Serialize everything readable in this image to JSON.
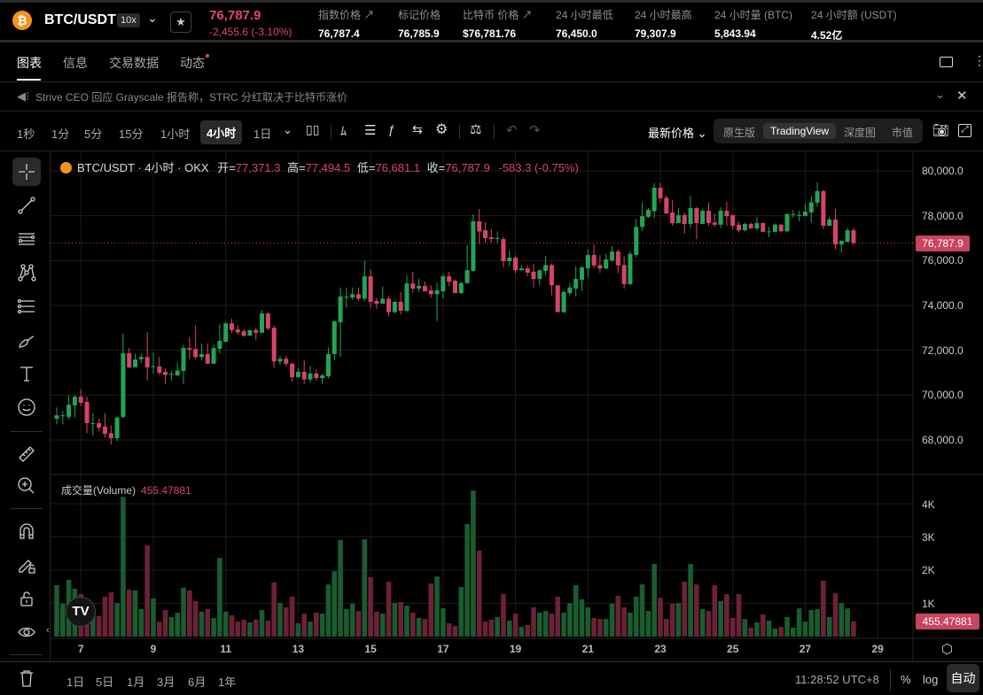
{
  "header": {
    "symbol": "BTC/USDT",
    "leverage": "10x",
    "last_price": "76,787.9",
    "change": "-2,455.6 (-3.10%)",
    "stats": [
      {
        "label": "指数价格 ↗",
        "value": "76,787.4"
      },
      {
        "label": "标记价格",
        "value": "76,785.9"
      },
      {
        "label": "比特币 价格 ↗",
        "value": "$76,781.76"
      },
      {
        "label": "24 小时最低",
        "value": "76,450.0"
      },
      {
        "label": "24 小时最高",
        "value": "79,307.9"
      },
      {
        "label": "24 小时量 (BTC)",
        "value": "5,843.94"
      },
      {
        "label": "24 小时额 (USDT)",
        "value": "4.52亿"
      }
    ]
  },
  "tabs": [
    "图表",
    "信息",
    "交易数据",
    "动态"
  ],
  "news": "Strive CEO 回应 Grayscale 报告称，STRC 分红取决于比特币涨价",
  "toolbar": {
    "intervals": [
      "1秒",
      "1分",
      "5分",
      "15分",
      "1小时",
      "4小时",
      "1日"
    ],
    "active_interval": "4小时",
    "price_source": "最新价格",
    "views": [
      "原生版",
      "TradingView",
      "深度图",
      "市值"
    ],
    "active_view": "TradingView"
  },
  "legend": {
    "title": "BTC/USDT · 4小时 · OKX",
    "open_label": "开=",
    "open": "77,371.3",
    "high_label": "高=",
    "high": "77,494.5",
    "low_label": "低=",
    "low": "76,681.1",
    "close_label": "收=",
    "close": "76,787.9",
    "change": "-583.3 (-0.75%)"
  },
  "volume_legend": {
    "label": "成交量(Volume)",
    "value": "455.47881"
  },
  "bottom": {
    "ranges": [
      "1日",
      "5日",
      "1月",
      "3月",
      "6月",
      "1年"
    ],
    "clock": "11:28:52 UTC+8",
    "percent": "%",
    "log": "log",
    "auto": "自动"
  },
  "colors": {
    "up": "#23a455",
    "down": "#d8436a",
    "vol_up": "#1a5c2e",
    "vol_down": "#6b2236",
    "price_tag": "#c8445f"
  },
  "chart_data": {
    "type": "candlestick",
    "interval": "4h",
    "price_axis": {
      "ticks": [
        "80,000.0",
        "78,000.0",
        "76,000.0",
        "74,000.0",
        "72,000.0",
        "70,000.0",
        "68,000.0"
      ],
      "tick_values": [
        80000,
        78000,
        76000,
        74000,
        72000,
        70000,
        68000
      ],
      "current": "76,787.9",
      "current_value": 76787.9
    },
    "volume_axis": {
      "ticks": [
        "4K",
        "3K",
        "2K",
        "1K"
      ],
      "tick_values": [
        4000,
        3000,
        2000,
        1000
      ],
      "current": "455.47881"
    },
    "x_ticks": [
      {
        "label": "7",
        "candle": 4
      },
      {
        "label": "9",
        "candle": 16
      },
      {
        "label": "11",
        "candle": 28
      },
      {
        "label": "13",
        "candle": 40
      },
      {
        "label": "15",
        "candle": 52
      },
      {
        "label": "17",
        "candle": 64
      },
      {
        "label": "19",
        "candle": 76
      },
      {
        "label": "21",
        "candle": 88
      },
      {
        "label": "23",
        "candle": 100
      },
      {
        "label": "25",
        "candle": 112
      },
      {
        "label": "27",
        "candle": 124
      },
      {
        "label": "29",
        "candle": 136
      }
    ],
    "ohlc": [
      [
        68950,
        69450,
        68700,
        69100
      ],
      [
        69100,
        69300,
        68700,
        69100
      ],
      [
        69030,
        70000,
        68900,
        69570
      ],
      [
        69540,
        70000,
        69000,
        69930
      ],
      [
        69930,
        70250,
        69500,
        69660
      ],
      [
        69700,
        69930,
        68300,
        68750
      ],
      [
        68750,
        69200,
        68200,
        68750
      ],
      [
        68750,
        68950,
        68400,
        68550
      ],
      [
        68600,
        69200,
        68100,
        68270
      ],
      [
        68300,
        68650,
        67800,
        68080
      ],
      [
        68080,
        69050,
        67950,
        69000
      ],
      [
        69030,
        72740,
        68950,
        71870
      ],
      [
        71870,
        72100,
        71200,
        71240
      ],
      [
        71240,
        71850,
        71240,
        71590
      ],
      [
        71600,
        71850,
        71450,
        71700
      ],
      [
        71700,
        72800,
        70650,
        71240
      ],
      [
        71280,
        71900,
        70950,
        71290
      ],
      [
        71280,
        71700,
        70900,
        71000
      ],
      [
        71040,
        71200,
        70500,
        70900
      ],
      [
        70950,
        71100,
        70650,
        70950
      ],
      [
        70880,
        71450,
        70850,
        71100
      ],
      [
        71080,
        72250,
        70500,
        72100
      ],
      [
        72100,
        72600,
        71600,
        72030
      ],
      [
        72060,
        73100,
        71600,
        71700
      ],
      [
        71700,
        72300,
        71550,
        71830
      ],
      [
        71830,
        72300,
        71400,
        71400
      ],
      [
        71400,
        72250,
        71400,
        72100
      ],
      [
        72070,
        73170,
        71850,
        72420
      ],
      [
        72380,
        73250,
        72350,
        73200
      ],
      [
        73200,
        73400,
        72750,
        72900
      ],
      [
        72930,
        73100,
        72700,
        72800
      ],
      [
        72850,
        72950,
        72600,
        72650
      ],
      [
        72650,
        72900,
        72650,
        72900
      ],
      [
        72900,
        73000,
        72450,
        72780
      ],
      [
        72780,
        73800,
        72780,
        73640
      ],
      [
        73640,
        73700,
        72900,
        72970
      ],
      [
        73000,
        73100,
        71200,
        71500
      ],
      [
        71500,
        71750,
        71350,
        71620
      ],
      [
        71620,
        71750,
        71300,
        71400
      ],
      [
        71400,
        71450,
        70600,
        70800
      ],
      [
        70800,
        71200,
        70800,
        71040
      ],
      [
        71040,
        71550,
        70500,
        70700
      ],
      [
        70700,
        71300,
        70550,
        70960
      ],
      [
        70960,
        71150,
        70650,
        70760
      ],
      [
        70760,
        70950,
        70500,
        70880
      ],
      [
        70840,
        72120,
        70750,
        71830
      ],
      [
        71830,
        73350,
        71550,
        73290
      ],
      [
        73250,
        74800,
        71700,
        74400
      ],
      [
        74390,
        74800,
        73900,
        74390
      ],
      [
        74350,
        74800,
        74250,
        74500
      ],
      [
        74500,
        74800,
        74200,
        74300
      ],
      [
        74300,
        76000,
        74200,
        75300
      ],
      [
        75300,
        75600,
        73900,
        74160
      ],
      [
        74200,
        74330,
        73850,
        74080
      ],
      [
        74080,
        74850,
        74080,
        74300
      ],
      [
        74300,
        74400,
        73500,
        73700
      ],
      [
        73700,
        74200,
        73650,
        74160
      ],
      [
        74160,
        74600,
        73600,
        73760
      ],
      [
        73760,
        75350,
        73700,
        74980
      ],
      [
        74980,
        75500,
        74570,
        74750
      ],
      [
        74750,
        75200,
        74600,
        74870
      ],
      [
        74870,
        75070,
        74650,
        74630
      ],
      [
        74670,
        74900,
        74350,
        74500
      ],
      [
        74500,
        75000,
        73300,
        74670
      ],
      [
        74630,
        75400,
        74300,
        75300
      ],
      [
        75300,
        75500,
        74850,
        75060
      ],
      [
        75100,
        75150,
        74550,
        74550
      ],
      [
        74550,
        75050,
        74500,
        75000
      ],
      [
        75000,
        76700,
        74950,
        75570
      ],
      [
        75540,
        78060,
        75500,
        77750
      ],
      [
        77750,
        78300,
        76750,
        77300
      ],
      [
        77350,
        77700,
        76800,
        77000
      ],
      [
        77040,
        77400,
        76800,
        76960
      ],
      [
        77000,
        77300,
        76750,
        77000
      ],
      [
        76960,
        77050,
        75700,
        75970
      ],
      [
        75970,
        76450,
        75750,
        76130
      ],
      [
        76130,
        76230,
        75430,
        75570
      ],
      [
        75570,
        75800,
        75570,
        75650
      ],
      [
        75650,
        75800,
        75300,
        75460
      ],
      [
        75500,
        75850,
        74800,
        75180
      ],
      [
        75180,
        75600,
        74900,
        75570
      ],
      [
        75540,
        76200,
        75350,
        75800
      ],
      [
        75800,
        75870,
        74450,
        74900
      ],
      [
        74900,
        74900,
        73700,
        73700
      ],
      [
        73700,
        74650,
        73650,
        74600
      ],
      [
        74550,
        75000,
        74450,
        74800
      ],
      [
        74750,
        75750,
        74400,
        75180
      ],
      [
        75140,
        75750,
        74650,
        75700
      ],
      [
        75650,
        76500,
        75250,
        76250
      ],
      [
        76250,
        76700,
        75650,
        75780
      ],
      [
        75800,
        76250,
        75450,
        75650
      ],
      [
        75650,
        76300,
        75600,
        76050
      ],
      [
        76000,
        76650,
        75950,
        76400
      ],
      [
        76400,
        76500,
        75450,
        75780
      ],
      [
        75800,
        76200,
        74750,
        74950
      ],
      [
        74950,
        76400,
        74900,
        76300
      ],
      [
        76250,
        77850,
        76150,
        77500
      ],
      [
        77500,
        78600,
        77300,
        77980
      ],
      [
        77950,
        78350,
        77900,
        78260
      ],
      [
        78200,
        79450,
        77900,
        79250
      ],
      [
        79250,
        79480,
        78600,
        78780
      ],
      [
        78800,
        78900,
        78100,
        78100
      ],
      [
        78140,
        78700,
        77550,
        77670
      ],
      [
        77670,
        78350,
        77670,
        78030
      ],
      [
        78030,
        78150,
        77200,
        77630
      ],
      [
        77630,
        78870,
        77450,
        78340
      ],
      [
        78340,
        78400,
        76950,
        77670
      ],
      [
        77630,
        78300,
        77630,
        78220
      ],
      [
        78220,
        78600,
        77550,
        77670
      ],
      [
        77700,
        78100,
        77500,
        77600
      ],
      [
        77600,
        78380,
        77450,
        78220
      ],
      [
        78220,
        78600,
        77550,
        77980
      ],
      [
        78030,
        78030,
        77400,
        77550
      ],
      [
        77600,
        77750,
        77250,
        77350
      ],
      [
        77350,
        77700,
        77300,
        77630
      ],
      [
        77630,
        77700,
        77550,
        77430
      ],
      [
        77430,
        77950,
        77350,
        77670
      ],
      [
        77670,
        77700,
        77270,
        77280
      ],
      [
        77300,
        77500,
        77050,
        77300
      ],
      [
        77280,
        77650,
        77280,
        77600
      ],
      [
        77600,
        77650,
        77300,
        77300
      ],
      [
        77300,
        78120,
        77300,
        78070
      ],
      [
        78070,
        78250,
        77900,
        78070
      ],
      [
        78030,
        78220,
        77750,
        78030
      ],
      [
        77980,
        78550,
        77980,
        78180
      ],
      [
        78140,
        78900,
        77700,
        78600
      ],
      [
        78580,
        79500,
        78400,
        79100
      ],
      [
        79100,
        79150,
        77400,
        77550
      ],
      [
        77550,
        77950,
        77550,
        77830
      ],
      [
        77830,
        78300,
        76500,
        76720
      ],
      [
        76720,
        76900,
        76350,
        76880
      ],
      [
        76840,
        77450,
        76800,
        77350
      ],
      [
        77350,
        77450,
        76680,
        76788
      ]
    ],
    "volume": [
      1550,
      990,
      1710,
      1440,
      1280,
      900,
      770,
      620,
      1200,
      1330,
      1010,
      4210,
      1410,
      1390,
      830,
      2750,
      1150,
      450,
      800,
      590,
      720,
      1470,
      1390,
      1070,
      750,
      830,
      560,
      2370,
      750,
      640,
      450,
      510,
      430,
      510,
      800,
      480,
      1630,
      1010,
      880,
      1200,
      400,
      690,
      450,
      720,
      690,
      1570,
      1970,
      2910,
      830,
      990,
      770,
      2930,
      1790,
      750,
      690,
      1650,
      1010,
      1040,
      930,
      720,
      560,
      530,
      1600,
      1810,
      850,
      400,
      320,
      1490,
      3390,
      4400,
      2590,
      450,
      510,
      590,
      1280,
      480,
      690,
      290,
      350,
      880,
      720,
      770,
      690,
      1200,
      720,
      1010,
      1550,
      1120,
      880,
      560,
      530,
      530,
      990,
      1230,
      880,
      720,
      1200,
      1570,
      770,
      2190,
      1170,
      530,
      990,
      1010,
      1650,
      2190,
      1570,
      830,
      770,
      1550,
      1070,
      1280,
      560,
      1280,
      530,
      270,
      430,
      670,
      480,
      240,
      290,
      590,
      270,
      850,
      450,
      800,
      830,
      1680,
      590,
      1310,
      1010,
      850,
      455
    ]
  }
}
